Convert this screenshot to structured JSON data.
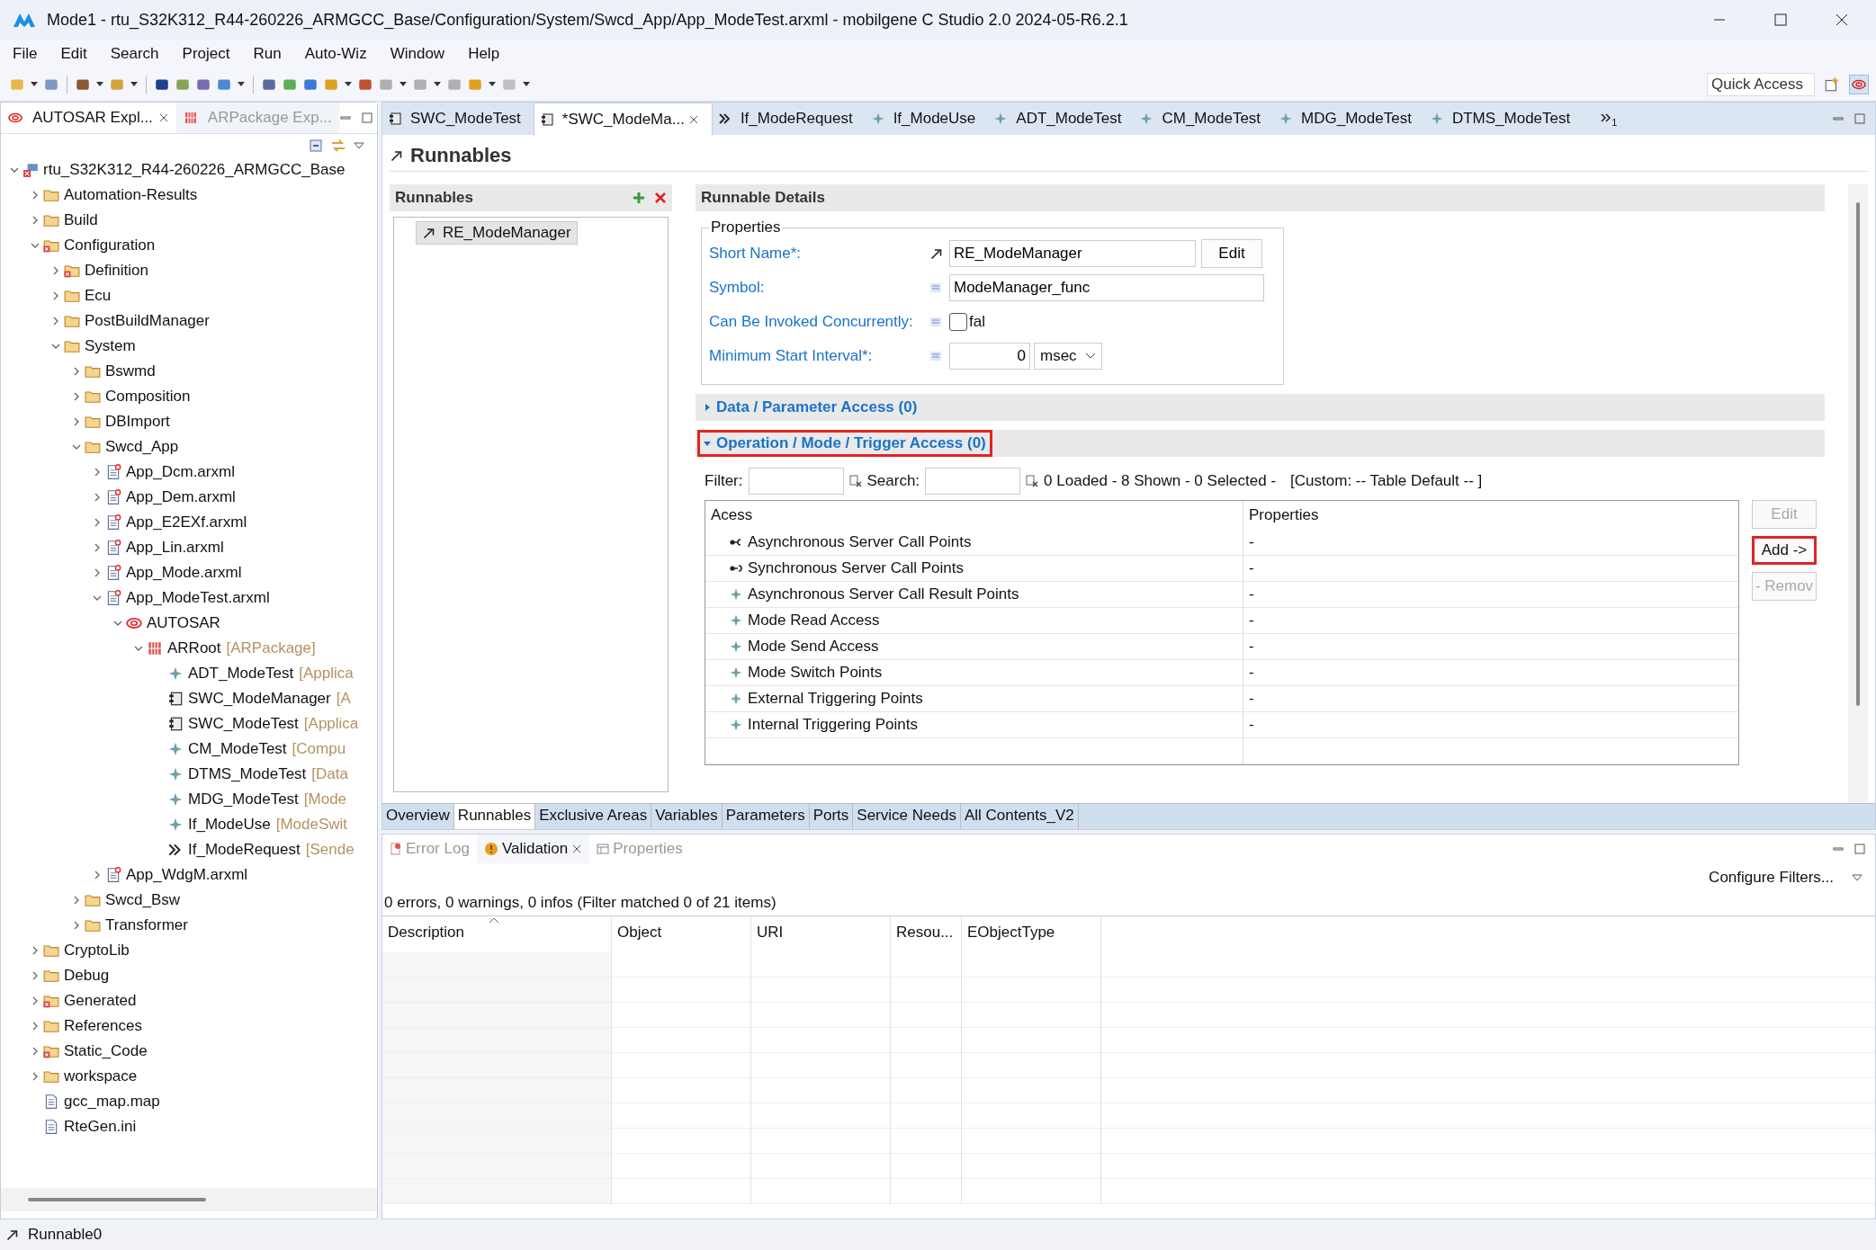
{
  "window": {
    "title": "Mode1 - rtu_S32K312_R44-260226_ARMGCC_Base/Configuration/System/Swcd_App/App_ModeTest.arxml - mobilgene C Studio 2.0 2024-05-R6.2.1"
  },
  "menu": [
    "File",
    "Edit",
    "Search",
    "Project",
    "Run",
    "Auto-Wiz",
    "Window",
    "Help"
  ],
  "quick_access": {
    "placeholder": "Quick Access"
  },
  "explorer": {
    "tabs": [
      {
        "label": "AUTOSAR Expl...",
        "selected": true
      },
      {
        "label": "ARPackage Exp...",
        "selected": false
      }
    ],
    "tree": [
      {
        "label": "rtu_S32K312_R44-260226_ARMGCC_Base",
        "kind": "project",
        "expanded": true,
        "children": [
          {
            "label": "Automation-Results",
            "kind": "folder",
            "expanded": false
          },
          {
            "label": "Build",
            "kind": "folder",
            "expanded": false
          },
          {
            "label": "Configuration",
            "kind": "folder-error",
            "expanded": true,
            "children": [
              {
                "label": "Definition",
                "kind": "folder-error",
                "expanded": false
              },
              {
                "label": "Ecu",
                "kind": "folder",
                "expanded": false
              },
              {
                "label": "PostBuildManager",
                "kind": "folder",
                "expanded": false
              },
              {
                "label": "System",
                "kind": "folder",
                "expanded": true,
                "children": [
                  {
                    "label": "Bswmd",
                    "kind": "folder",
                    "expanded": false
                  },
                  {
                    "label": "Composition",
                    "kind": "folder",
                    "expanded": false
                  },
                  {
                    "label": "DBImport",
                    "kind": "folder",
                    "expanded": false
                  },
                  {
                    "label": "Swcd_App",
                    "kind": "folder",
                    "expanded": true,
                    "children": [
                      {
                        "label": "App_Dcm.arxml",
                        "kind": "arxml",
                        "expanded": false
                      },
                      {
                        "label": "App_Dem.arxml",
                        "kind": "arxml",
                        "expanded": false
                      },
                      {
                        "label": "App_E2EXf.arxml",
                        "kind": "arxml",
                        "expanded": false
                      },
                      {
                        "label": "App_Lin.arxml",
                        "kind": "arxml",
                        "expanded": false
                      },
                      {
                        "label": "App_Mode.arxml",
                        "kind": "arxml",
                        "expanded": false
                      },
                      {
                        "label": "App_ModeTest.arxml",
                        "kind": "arxml",
                        "expanded": true,
                        "children": [
                          {
                            "label": "AUTOSAR",
                            "kind": "autosar",
                            "expanded": true,
                            "children": [
                              {
                                "label": "ARRoot",
                                "type": "[ARPackage]",
                                "kind": "package",
                                "expanded": true,
                                "children": [
                                  {
                                    "label": "ADT_ModeTest",
                                    "type": "[Applica",
                                    "kind": "element"
                                  },
                                  {
                                    "label": "SWC_ModeManager",
                                    "type": "[A",
                                    "kind": "swc"
                                  },
                                  {
                                    "label": "SWC_ModeTest",
                                    "type": "[Applica",
                                    "kind": "swc"
                                  },
                                  {
                                    "label": "CM_ModeTest",
                                    "type": "[Compu",
                                    "kind": "element"
                                  },
                                  {
                                    "label": "DTMS_ModeTest",
                                    "type": "[Data",
                                    "kind": "element"
                                  },
                                  {
                                    "label": "MDG_ModeTest",
                                    "type": "[Mode",
                                    "kind": "element"
                                  },
                                  {
                                    "label": "If_ModeUse",
                                    "type": "[ModeSwit",
                                    "kind": "element"
                                  },
                                  {
                                    "label": "If_ModeRequest",
                                    "type": "[Sende",
                                    "kind": "send-if"
                                  }
                                ]
                              }
                            ]
                          }
                        ]
                      },
                      {
                        "label": "App_WdgM.arxml",
                        "kind": "arxml",
                        "expanded": false
                      }
                    ]
                  },
                  {
                    "label": "Swcd_Bsw",
                    "kind": "folder",
                    "expanded": false
                  },
                  {
                    "label": "Transformer",
                    "kind": "folder",
                    "expanded": false
                  }
                ]
              }
            ]
          },
          {
            "label": "CryptoLib",
            "kind": "folder",
            "expanded": false
          },
          {
            "label": "Debug",
            "kind": "folder",
            "expanded": false
          },
          {
            "label": "Generated",
            "kind": "folder-error",
            "expanded": false
          },
          {
            "label": "References",
            "kind": "folder",
            "expanded": false
          },
          {
            "label": "Static_Code",
            "kind": "folder-error",
            "expanded": false
          },
          {
            "label": "workspace",
            "kind": "folder",
            "expanded": false
          },
          {
            "label": "gcc_map.map",
            "kind": "file"
          },
          {
            "label": "RteGen.ini",
            "kind": "file"
          }
        ]
      }
    ]
  },
  "editor_tabs": [
    {
      "label": "SWC_ModeTest",
      "kind": "swc",
      "selected": false
    },
    {
      "label": "*SWC_ModeMa...",
      "kind": "swc",
      "selected": true
    },
    {
      "label": "If_ModeRequest",
      "kind": "send-if",
      "selected": false
    },
    {
      "label": "If_ModeUse",
      "kind": "element",
      "selected": false
    },
    {
      "label": "ADT_ModeTest",
      "kind": "element",
      "selected": false
    },
    {
      "label": "CM_ModeTest",
      "kind": "element",
      "selected": false
    },
    {
      "label": "MDG_ModeTest",
      "kind": "element",
      "selected": false
    },
    {
      "label": "DTMS_ModeTest",
      "kind": "element",
      "selected": false
    }
  ],
  "tab_overflow": "1",
  "editor": {
    "title": "Runnables",
    "runnables": {
      "title": "Runnables",
      "items": [
        {
          "label": "RE_ModeManager",
          "selected": true
        }
      ]
    },
    "details": {
      "title": "Runnable Details",
      "group": "Properties",
      "fields": [
        {
          "label": "Short Name*:",
          "kind": "text",
          "value": "RE_ModeManager",
          "button": "Edit"
        },
        {
          "label": "Symbol:",
          "kind": "text",
          "value": "ModeManager_func"
        },
        {
          "label": "Can Be Invoked Concurrently:",
          "kind": "checkbox",
          "checked": false,
          "value": "fal"
        },
        {
          "label": "Minimum Start Interval*:",
          "kind": "number",
          "value": "0",
          "unit": "msec"
        }
      ],
      "sections": [
        {
          "title": "Data / Parameter Access (0)",
          "expanded": false,
          "highlighted": false
        },
        {
          "title": "Operation / Mode / Trigger Access (0)",
          "expanded": true,
          "highlighted": true
        }
      ],
      "filter_label": "Filter:",
      "search_label": "Search:",
      "status": "0 Loaded - 8 Shown - 0 Selected -",
      "custom": "[Custom: -- Table Default -- ]",
      "columns": [
        "Acess",
        "Properties"
      ],
      "rows": [
        {
          "access": "Asynchronous Server Call Points",
          "kind": "async-call",
          "properties": "-"
        },
        {
          "access": "Synchronous Server Call Points",
          "kind": "sync-call",
          "properties": "-"
        },
        {
          "access": "Asynchronous Server Call Result Points",
          "kind": "element",
          "properties": "-"
        },
        {
          "access": "Mode Read Access",
          "kind": "element",
          "properties": "-"
        },
        {
          "access": "Mode Send Access",
          "kind": "element",
          "properties": "-"
        },
        {
          "access": "Mode Switch Points",
          "kind": "element",
          "properties": "-"
        },
        {
          "access": "External Triggering Points",
          "kind": "element",
          "properties": "-"
        },
        {
          "access": "Internal Triggering Points",
          "kind": "element",
          "properties": "-"
        }
      ],
      "buttons": [
        {
          "label": "Edit",
          "disabled": true,
          "highlighted": false
        },
        {
          "label": "Add ->",
          "disabled": false,
          "highlighted": true
        },
        {
          "label": "- Remov",
          "disabled": true,
          "highlighted": false
        }
      ]
    },
    "pages": [
      {
        "label": "Overview",
        "selected": false
      },
      {
        "label": "Runnables",
        "selected": true
      },
      {
        "label": "Exclusive Areas",
        "selected": false
      },
      {
        "label": "Variables",
        "selected": false
      },
      {
        "label": "Parameters",
        "selected": false
      },
      {
        "label": "Ports",
        "selected": false
      },
      {
        "label": "Service Needs",
        "selected": false
      },
      {
        "label": "All Contents_V2",
        "selected": false
      }
    ]
  },
  "bottom": {
    "tabs": [
      {
        "label": "Error Log",
        "selected": false
      },
      {
        "label": "Validation",
        "selected": true
      },
      {
        "label": "Properties",
        "selected": false
      }
    ],
    "configure": "Configure Filters...",
    "summary": "0 errors, 0 warnings, 0 infos (Filter matched 0 of 21 items)",
    "columns": [
      "Description",
      "Object",
      "URI",
      "Resou...",
      "EObjectType"
    ]
  },
  "status_bar": "Runnable0"
}
